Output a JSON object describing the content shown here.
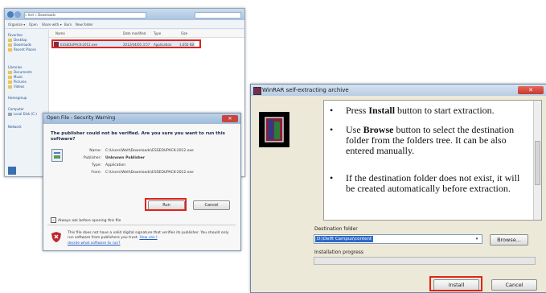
{
  "explorer": {
    "address": "« Inst » Downloads",
    "menu": [
      "Organize ▾",
      "Open",
      "Share with ▾",
      "Burn",
      "New folder"
    ],
    "columns": [
      "Name",
      "Date modified",
      "Type",
      "Size"
    ],
    "nav_items": [
      "Favorites",
      "Desktop",
      "Downloads",
      "Recent Places",
      "Libraries",
      "Documents",
      "Music",
      "Pictures",
      "Videos",
      "Homegroup",
      "Computer",
      "Local Disk (C:)",
      "Network"
    ],
    "file": {
      "name": "ESSEDUPACK-2012.exe",
      "date": "2012/04/05 3:57",
      "type": "Application",
      "size": "1,650 KB"
    }
  },
  "security_dialog": {
    "title": "Open File - Security Warning",
    "close": "✕",
    "heading": "The publisher could not be verified.  Are you sure you want to run this software?",
    "fields": [
      {
        "label": "Name:",
        "value": "C:\\Users\\Welt\\Downloads\\ESSEDUPACK-2012.exe"
      },
      {
        "label": "Publisher:",
        "value": "Unknown Publisher"
      },
      {
        "label": "Type:",
        "value": "Application"
      },
      {
        "label": "From:",
        "value": "C:\\Users\\Welt\\Downloads\\ESSEDUPACK-2012.exe"
      }
    ],
    "run_label": "Run",
    "cancel_label": "Cancel",
    "checkbox_label": "Always ask before opening this file",
    "checkbox_mark": "✓",
    "footer_text": "This file does not have a valid digital signature that verifies its publisher. You should only run software from publishers you trust.",
    "footer_link_inline": "How can I",
    "footer_link": "decide what software to run?"
  },
  "winrar": {
    "title": "WinRAR self-extracting archive",
    "close": "✕",
    "instructions": [
      {
        "before": "Press ",
        "bold": "Install",
        "after": " button to start extraction."
      },
      {
        "before": "Use ",
        "bold": "Browse",
        "after": " button to select the destination folder from the folders tree. It can be also entered manually."
      },
      {
        "before": "",
        "bold": "",
        "after": "If the destination folder does not exist, it will be created automatically before extraction."
      }
    ],
    "bullet": "•",
    "destination_label": "Destination folder",
    "destination_value": "D:\\Delft Campus\\content",
    "dropdown_arrow": "▾",
    "browse_label": "Browse...",
    "progress_label": "Installation progress",
    "progress_fraction": 0,
    "install_label": "Install",
    "cancel_label": "Cancel"
  },
  "colors": {
    "highlight": "#e0241b",
    "progress": "#3ca03c",
    "selection": "#316ac5"
  }
}
